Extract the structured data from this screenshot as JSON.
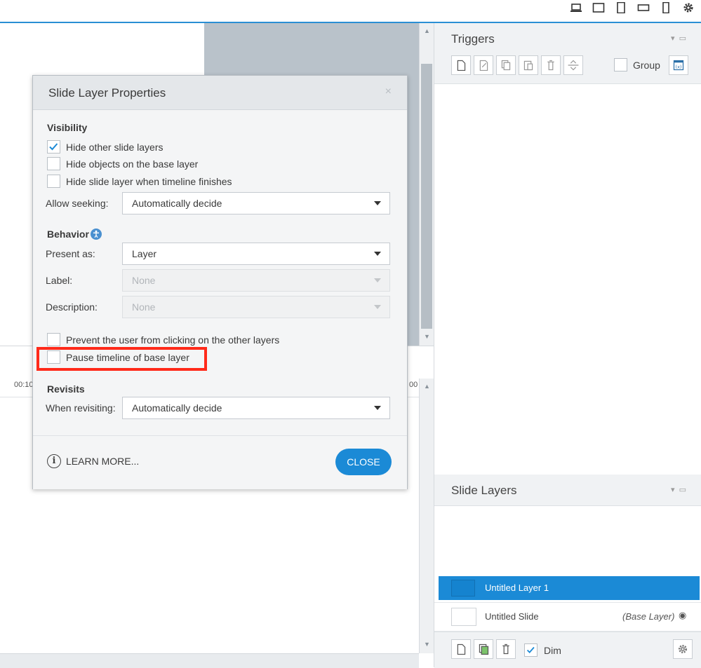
{
  "dialog": {
    "title": "Slide Layer Properties",
    "close_icon": "×",
    "visibility": {
      "heading": "Visibility",
      "hide_other_layers": {
        "label": "Hide other slide layers",
        "checked": true
      },
      "hide_base_objects": {
        "label": "Hide objects on the base layer",
        "checked": false
      },
      "hide_when_finished": {
        "label": "Hide slide layer when timeline finishes",
        "checked": false
      },
      "allow_seeking": {
        "label": "Allow seeking:",
        "value": "Automatically decide"
      }
    },
    "behavior": {
      "heading": "Behavior",
      "present_as": {
        "label": "Present as:",
        "value": "Layer"
      },
      "label_field": {
        "label": "Label:",
        "value": "None"
      },
      "description_field": {
        "label": "Description:",
        "value": "None"
      },
      "prevent_clicking": {
        "label": "Prevent the user from clicking on the other layers",
        "checked": false
      },
      "pause_timeline": {
        "label": "Pause timeline of base layer",
        "checked": false
      }
    },
    "revisits": {
      "heading": "Revisits",
      "when_revisiting": {
        "label": "When revisiting:",
        "value": "Automatically decide"
      }
    },
    "footer": {
      "learn_more": "LEARN MORE...",
      "close": "CLOSE"
    }
  },
  "triggers": {
    "title": "Triggers",
    "group_label": "Group"
  },
  "slide_layers": {
    "title": "Slide Layers",
    "layers": [
      {
        "name": "Untitled Layer 1",
        "selected": true,
        "tag": ""
      },
      {
        "name": "Untitled Slide",
        "selected": false,
        "tag": "(Base Layer)"
      }
    ],
    "dim_label": "Dim"
  },
  "timeline": {
    "ruler_left": "00:10",
    "ruler_right": "00"
  },
  "colors": {
    "accent": "#1b8ad6",
    "highlight": "#ff2a1a",
    "selected_row": "#1b8ad6"
  }
}
